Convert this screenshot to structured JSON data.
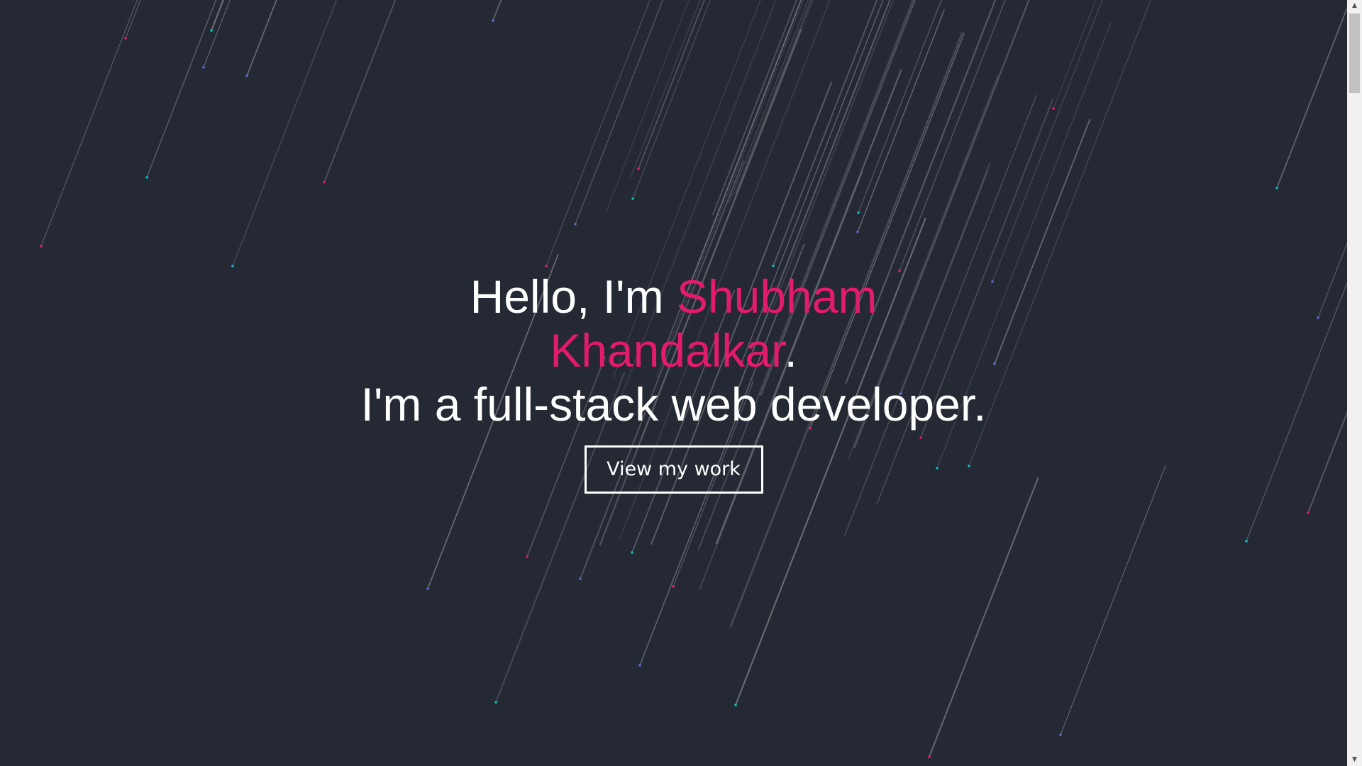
{
  "hero": {
    "greeting_prefix": "Hello, I'm ",
    "first_name": "Shubham",
    "last_name": "Khandalkar",
    "greeting_suffix": ".",
    "tagline": "I'm a full-stack web developer.",
    "cta_label": "View my work"
  },
  "colors": {
    "background": "#252934",
    "accent": "#e31b6d",
    "text": "#ffffff",
    "dot_teal": "#04c2c9",
    "dot_blue": "#5b6bd6"
  },
  "scrollbar": {
    "up_icon": "triangle-up-icon",
    "down_icon": "triangle-down-icon"
  }
}
